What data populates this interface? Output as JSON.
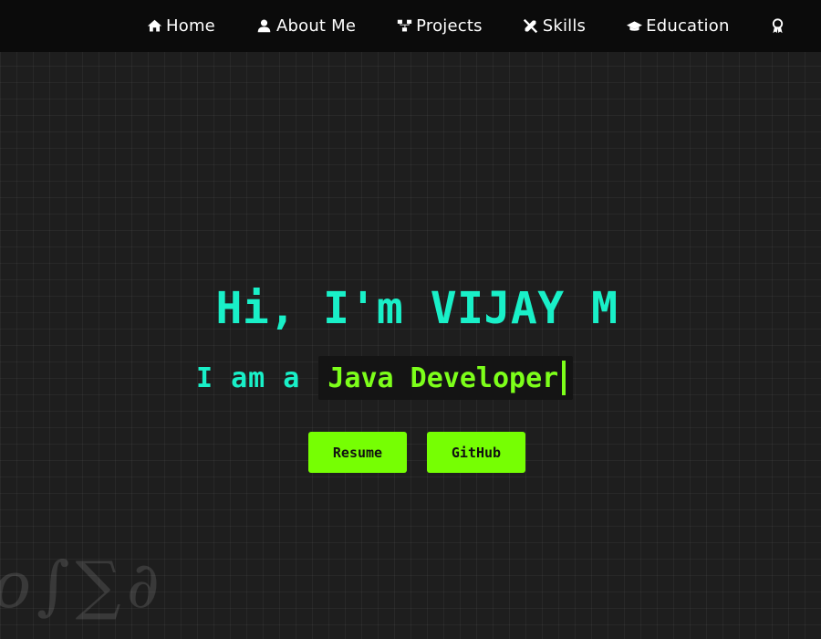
{
  "nav": {
    "items": [
      {
        "label": "Home",
        "icon": "home-icon"
      },
      {
        "label": "About Me",
        "icon": "user-icon"
      },
      {
        "label": "Projects",
        "icon": "sitemap-icon"
      },
      {
        "label": "Skills",
        "icon": "tools-icon"
      },
      {
        "label": "Education",
        "icon": "graduation-cap-icon"
      }
    ],
    "overflow_icon": "award-icon"
  },
  "hero": {
    "title": "Hi, I'm VIJAY M",
    "subtitle_prefix": "I am a",
    "typed_text": "Java Developer",
    "buttons": {
      "resume": "Resume",
      "github": "GitHub"
    }
  },
  "decoration": {
    "math_symbols": "o∫∑∂"
  },
  "colors": {
    "background": "#1e1e1e",
    "navbar": "#0b0b0b",
    "title_teal": "#19f0c8",
    "accent_green": "#76ff03",
    "typed_green": "#7dff1a"
  }
}
